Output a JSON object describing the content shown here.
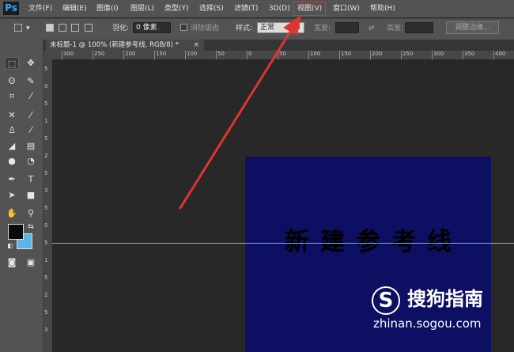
{
  "app": {
    "logo": "Ps"
  },
  "menu": {
    "items": [
      "文件(F)",
      "编辑(E)",
      "图像(I)",
      "图层(L)",
      "类型(Y)",
      "选择(S)",
      "滤镜(T)",
      "3D(D)",
      "视图(V)",
      "窗口(W)",
      "帮助(H)"
    ],
    "highlighted": "视图(V)",
    "highlight_color": "#e0342e"
  },
  "options": {
    "feather_label": "羽化:",
    "feather_value": "0 像素",
    "antialias_label": "消除锯齿",
    "style_label": "样式:",
    "style_value": "正常",
    "width_label": "宽度:",
    "height_label": "高度:",
    "refine_button": "调整边缘..."
  },
  "document": {
    "tab_title": "未标题-1 @ 100% (新建参考线, RGB/8) *",
    "close": "×",
    "canvas_text": "新建参考线",
    "background_color": "#0d0f62",
    "guide_color": "#18e0f0"
  },
  "ruler": {
    "h_ticks": [
      "300",
      "250",
      "200",
      "150",
      "100",
      "50",
      "0",
      "50",
      "100",
      "150",
      "200",
      "250",
      "300",
      "350",
      "400"
    ],
    "v_ticks": [
      "5",
      "0",
      "5",
      "1",
      "5",
      "2",
      "5",
      "3",
      "5",
      "0",
      "5",
      "1",
      "5",
      "2",
      "5",
      "3"
    ]
  },
  "colors": {
    "foreground": "#0a0a0a",
    "background": "#5fb4e6",
    "arrow": "#e0342e"
  },
  "watermark": {
    "brand": "搜狗指南",
    "url": "zhinan.sogou.com"
  }
}
